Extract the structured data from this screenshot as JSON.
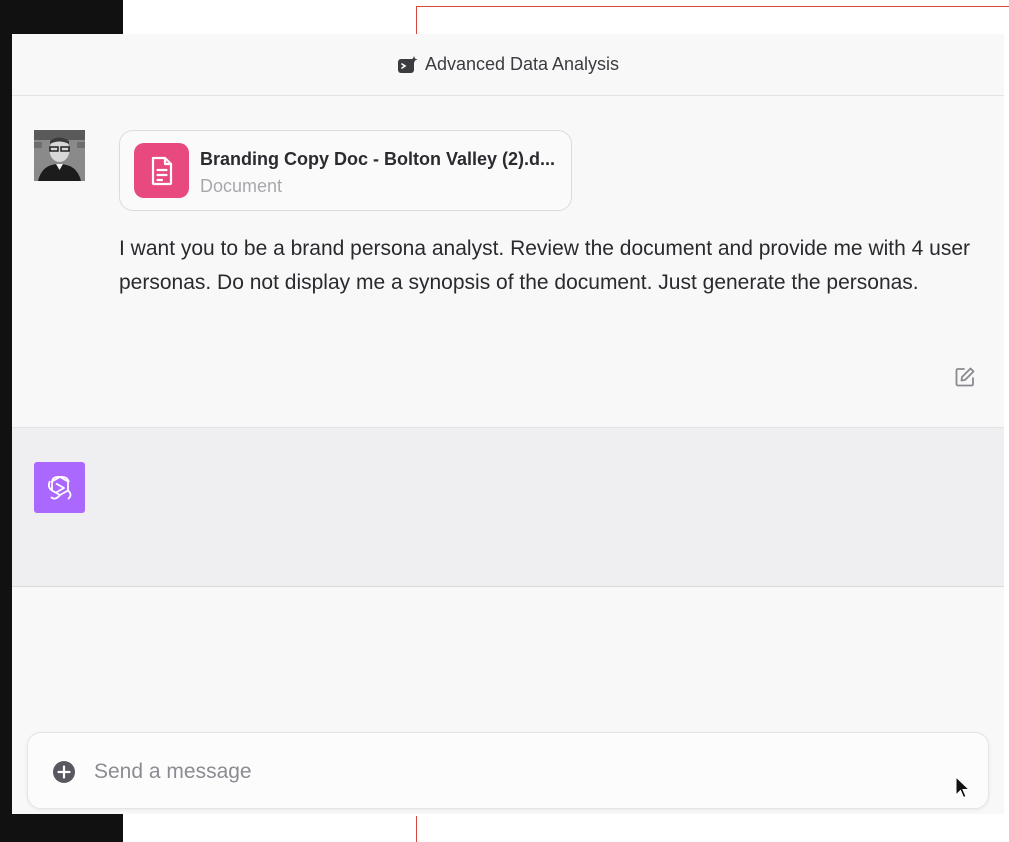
{
  "header": {
    "title": "Advanced Data Analysis",
    "icon": "data-analysis-icon"
  },
  "user_message": {
    "avatar": "user-avatar-photo",
    "attachment": {
      "name": "Branding Copy Doc - Bolton Valley (2).d...",
      "type": "Document",
      "icon": "document-icon",
      "icon_color": "#e84a7f"
    },
    "text": "I want you to be a brand persona analyst. Review the document and provide me with 4 user personas. Do not display me a synopsis of the document. Just generate the personas.",
    "edit_icon": "edit-icon"
  },
  "assistant_message": {
    "avatar": "chatgpt-logo-icon",
    "avatar_color": "#ab68ff",
    "text": ""
  },
  "composer": {
    "placeholder": "Send a message",
    "value": "",
    "attach_icon": "plus-circle-icon"
  },
  "colors": {
    "accent_red": "#d9463b",
    "background": "#f9f8f9",
    "assistant_bg": "#efeef0"
  }
}
